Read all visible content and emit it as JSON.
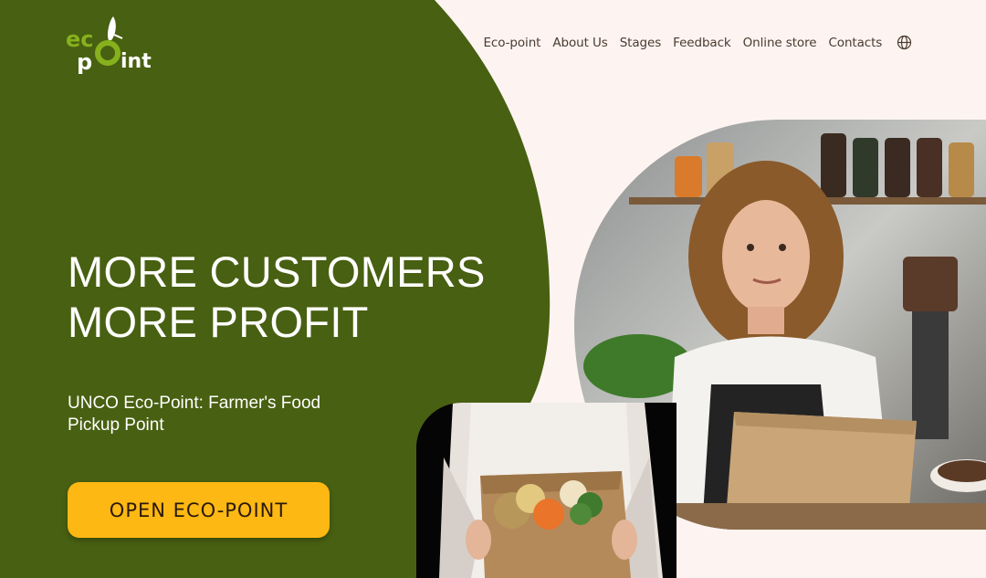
{
  "brand": {
    "logo_text_top": "ec",
    "logo_text_bottom_left": "p",
    "logo_text_bottom_right": "int",
    "logo_name": "eco-point-logo",
    "colors": {
      "green": "#486011",
      "light_green": "#86b11c",
      "yellow": "#fdb813",
      "bg": "#fdf4f1"
    }
  },
  "nav": {
    "items": [
      {
        "label": "Eco-point"
      },
      {
        "label": "About Us"
      },
      {
        "label": "Stages"
      },
      {
        "label": "Feedback"
      },
      {
        "label": "Online store"
      },
      {
        "label": "Contacts"
      }
    ],
    "language_icon": "globe-icon"
  },
  "hero": {
    "title_line1": "MORE CUSTOMERS",
    "title_line2": "MORE PROFIT",
    "subtitle": "UNCO Eco-Point: Farmer's Food Pickup Point",
    "cta_label": "OPEN ECO-POINT"
  },
  "images": {
    "main_photo": "woman-with-paper-bag-photo",
    "secondary_photo": "vegetable-bag-photo"
  }
}
